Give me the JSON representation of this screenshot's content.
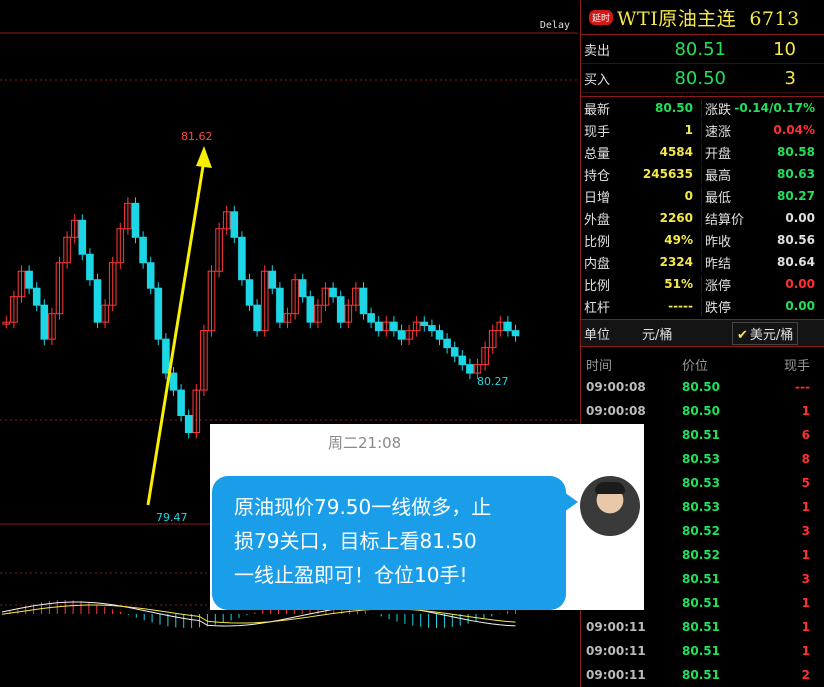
{
  "chart": {
    "delay_label": "Delay",
    "high_label": "81.62",
    "low_label": "79.47",
    "recent_low_label": "80.27",
    "colors": {
      "up": "#ff3a3a",
      "down": "#1cd6e6",
      "arrow": "#f8f000",
      "grid": "#8b1a1a"
    }
  },
  "header": {
    "badge": "延时",
    "symbol": "WTI原油主连",
    "code": "6713"
  },
  "quote": {
    "sell_label": "卖出",
    "sell_price": "80.51",
    "sell_vol": "10",
    "buy_label": "买入",
    "buy_price": "80.50",
    "buy_vol": "3"
  },
  "stats": [
    {
      "k1": "最新",
      "v1": "80.50",
      "c1": "#22e05a",
      "k2": "涨跌",
      "v2": "-0.14/0.17%",
      "c2": "#22e05a"
    },
    {
      "k1": "现手",
      "v1": "1",
      "c1": "#f4e84c",
      "k2": "速涨",
      "v2": "0.04%",
      "c2": "#ff3030"
    },
    {
      "k1": "总量",
      "v1": "4584",
      "c1": "#f4e84c",
      "k2": "开盘",
      "v2": "80.58",
      "c2": "#22e05a"
    },
    {
      "k1": "持仓",
      "v1": "245635",
      "c1": "#f4e84c",
      "k2": "最高",
      "v2": "80.63",
      "c2": "#22e05a"
    },
    {
      "k1": "日增",
      "v1": "0",
      "c1": "#f4e84c",
      "k2": "最低",
      "v2": "80.27",
      "c2": "#22e05a"
    },
    {
      "k1": "外盘",
      "v1": "2260",
      "c1": "#f4e84c",
      "k2": "结算价",
      "v2": "0.00",
      "c2": "#e0e0e0"
    },
    {
      "k1": "比例",
      "v1": "49%",
      "c1": "#f4e84c",
      "k2": "昨收",
      "v2": "80.56",
      "c2": "#e0e0e0"
    },
    {
      "k1": "内盘",
      "v1": "2324",
      "c1": "#f4e84c",
      "k2": "昨结",
      "v2": "80.64",
      "c2": "#e0e0e0"
    },
    {
      "k1": "比例",
      "v1": "51%",
      "c1": "#f4e84c",
      "k2": "涨停",
      "v2": "0.00",
      "c2": "#ff3030"
    },
    {
      "k1": "杠杆",
      "v1": "-----",
      "c1": "#f4e84c",
      "k2": "跌停",
      "v2": "0.00",
      "c2": "#22e05a"
    }
  ],
  "unit": {
    "label": "单位",
    "unit1": "元/桶",
    "unit2": "美元/桶"
  },
  "ticks": {
    "headers": [
      "时间",
      "价位",
      "现手"
    ],
    "rows": [
      {
        "t": "09:00:08",
        "p": "80.50",
        "q": "---"
      },
      {
        "t": "09:00:08",
        "p": "80.50",
        "q": "1"
      },
      {
        "t": "",
        "p": "80.51",
        "q": "6"
      },
      {
        "t": "",
        "p": "80.53",
        "q": "8"
      },
      {
        "t": "",
        "p": "80.53",
        "q": "5"
      },
      {
        "t": "",
        "p": "80.53",
        "q": "1"
      },
      {
        "t": "",
        "p": "80.52",
        "q": "3"
      },
      {
        "t": "",
        "p": "80.52",
        "q": "1"
      },
      {
        "t": "",
        "p": "80.51",
        "q": "3"
      },
      {
        "t": "",
        "p": "80.51",
        "q": "1"
      },
      {
        "t": "09:00:11",
        "p": "80.51",
        "q": "1"
      },
      {
        "t": "09:00:11",
        "p": "80.51",
        "q": "1"
      },
      {
        "t": "09:00:11",
        "p": "80.51",
        "q": "2"
      }
    ]
  },
  "overlay": {
    "timestamp": "周二21:08",
    "message_line1": "原油现价79.50一线做多，止",
    "message_line2": "损79关口，目标上看81.50",
    "message_line3": "一线止盈即可！仓位10手!"
  }
}
